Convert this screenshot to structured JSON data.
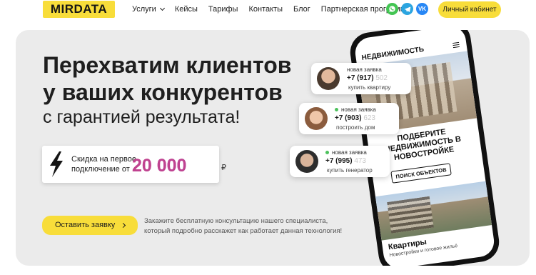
{
  "header": {
    "logo": "MIRDATA",
    "nav": [
      {
        "label": "Услуги",
        "dropdown": true
      },
      {
        "label": "Кейсы",
        "dropdown": false
      },
      {
        "label": "Тарифы",
        "dropdown": false
      },
      {
        "label": "Контакты",
        "dropdown": false
      },
      {
        "label": "Блог",
        "dropdown": false
      },
      {
        "label": "Партнерская программа",
        "dropdown": false
      }
    ],
    "socials": [
      {
        "icon": "whatsapp-icon",
        "color": "#43c553"
      },
      {
        "icon": "telegram-icon",
        "color": "#2ca5e0"
      },
      {
        "icon": "vk-icon",
        "color": "#2787f5"
      }
    ],
    "cabinet_label": "Личный кабинет"
  },
  "hero": {
    "title_line1": "Перехватим клиентов",
    "title_line2": "у ваших конкурентов",
    "subtitle": "с гарантией результата!",
    "promo": {
      "text_line1": "Скидка на первое",
      "text_line2": "подключение от",
      "amount": "20 000",
      "currency": "₽"
    },
    "cta_label": "Оставить заявку",
    "cta_desc_line1": "Закажите бесплатную консультацию нашего специалиста,",
    "cta_desc_line2": "который подробно расскажет как работает данная технология!"
  },
  "leads": [
    {
      "tag": "новая заявка",
      "phone": "+7 (917)",
      "phone_fade": "502",
      "note": "купить квартиру",
      "dot": false
    },
    {
      "tag": "новая заявка",
      "phone": "+7 (903)",
      "phone_fade": "623",
      "note": "построить дом",
      "dot": true
    },
    {
      "tag": "новая заявка",
      "phone": "+7 (995)",
      "phone_fade": "473",
      "note": "купить генератор",
      "dot": true
    }
  ],
  "phone_screen": {
    "header": "НЕДВИЖИМОСТЬ",
    "headline": "ПОДБЕРИТЕ НЕДВИЖИМОСТЬ В НОВОСТРОЙКЕ",
    "search_label": "ПОИСК ОБЪЕКТОВ",
    "category": "Квартиры",
    "category_sub": "Новостройки и готовое жильё"
  },
  "colors": {
    "accent": "#f8dd3a",
    "hero_bg": "#ebebeb",
    "amount_gradient_start": "#e63e6d",
    "amount_gradient_end": "#8a4fd6"
  }
}
